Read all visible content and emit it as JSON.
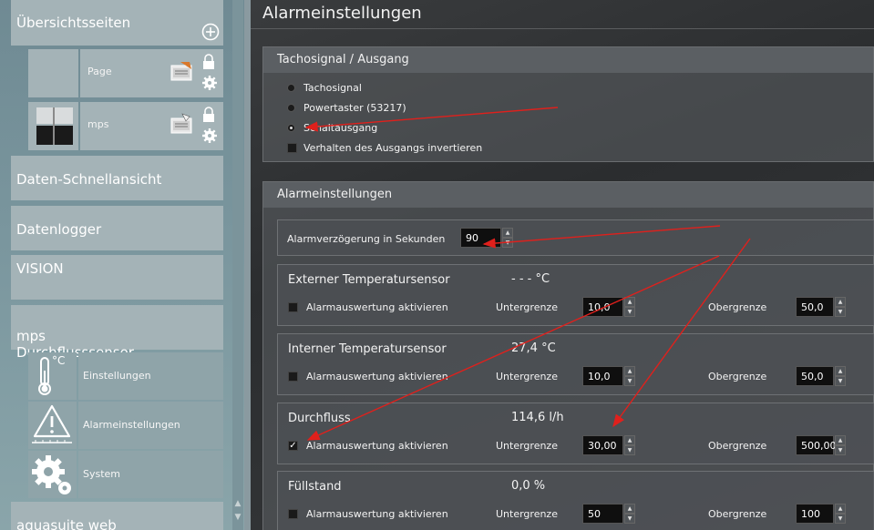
{
  "sidebar": {
    "overview": "Übersichtsseiten",
    "pages": [
      {
        "label": "Page"
      },
      {
        "label": "mps"
      }
    ],
    "items": [
      {
        "label": "Daten-Schnellansicht"
      },
      {
        "label": "Datenlogger"
      },
      {
        "label": "VISION"
      },
      {
        "label": "mps\nDurchflusssensor"
      }
    ],
    "sub_items": [
      {
        "label": "Einstellungen",
        "icon": "thermometer-icon",
        "unit": "°C"
      },
      {
        "label": "Alarmeinstellungen",
        "icon": "warning-icon"
      },
      {
        "label": "System",
        "icon": "gear-icon"
      }
    ],
    "footer": "aquasuite web"
  },
  "main": {
    "title": "Alarmeinstellungen",
    "tacho_panel": {
      "title": "Tachosignal / Ausgang",
      "options": [
        {
          "label": "Tachosignal",
          "selected": false
        },
        {
          "label": "Powertaster (53217)",
          "selected": false
        },
        {
          "label": "Schaltausgang",
          "selected": true
        }
      ],
      "invert_label": "Verhalten des Ausgangs invertieren"
    },
    "alarm_panel": {
      "title": "Alarmeinstellungen",
      "delay_label": "Alarmverzögerung in Sekunden",
      "delay_value": "90",
      "lower_label": "Untergrenze",
      "upper_label": "Obergrenze",
      "enable_label": "Alarmauswertung aktivieren",
      "sensors": [
        {
          "title": "Externer Temperatursensor",
          "value": "- - - °C",
          "checked": false,
          "lower": "10,0",
          "upper": "50,0"
        },
        {
          "title": "Interner Temperatursensor",
          "value": "27,4 °C",
          "checked": false,
          "lower": "10,0",
          "upper": "50,0"
        },
        {
          "title": "Durchfluss",
          "value": "114,6 l/h",
          "checked": true,
          "lower": "30,00",
          "upper": "500,00"
        },
        {
          "title": "Füllstand",
          "value": "0,0 %",
          "checked": false,
          "lower": "50",
          "upper": "100"
        }
      ]
    }
  },
  "colors": {
    "accent_arrow": "#e0201c",
    "sidebar_tile": "#a4b3b7",
    "panel_head": "#5b5f63"
  }
}
